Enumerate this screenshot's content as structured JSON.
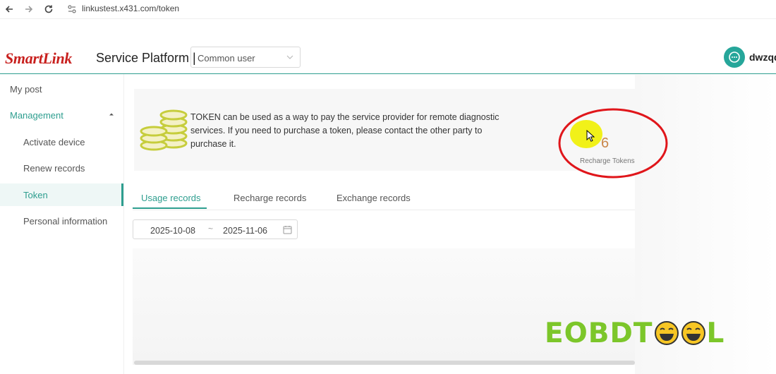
{
  "browser": {
    "url": "linkustest.x431.com/token",
    "back_icon": "arrow-left-icon",
    "forward_icon": "arrow-right-icon",
    "reload_icon": "reload-icon"
  },
  "header": {
    "logo": "SmartLink",
    "title": "Service Platform |",
    "role_select": {
      "value": "Common user"
    },
    "username": "dwzqq",
    "avatar_icon": "chat-bubble-icon"
  },
  "sidebar": {
    "my_post": "My post",
    "management": "Management",
    "items": [
      {
        "label": "Activate device"
      },
      {
        "label": "Renew records"
      },
      {
        "label": "Token",
        "active": true
      },
      {
        "label": "Personal information"
      }
    ]
  },
  "token_card": {
    "description": "TOKEN can be used as a way to pay the service provider for remote diagnostic services. If you need to purchase a token, please contact the other party to purchase it.",
    "count": "6",
    "recharge_label": "Recharge Tokens"
  },
  "tabs": [
    {
      "label": "Usage records",
      "active": true
    },
    {
      "label": "Recharge records"
    },
    {
      "label": "Exchange records"
    }
  ],
  "date_range": {
    "start": "2025-10-08",
    "separator": "~",
    "end": "2025-11-06"
  },
  "watermark": {
    "text_left": "EOBDT",
    "text_right": "L"
  },
  "colors": {
    "accent": "#2e9e8f",
    "logo_red": "#c8201e",
    "annotation_red": "#e0161b",
    "watermark_green": "#7cc62a"
  }
}
